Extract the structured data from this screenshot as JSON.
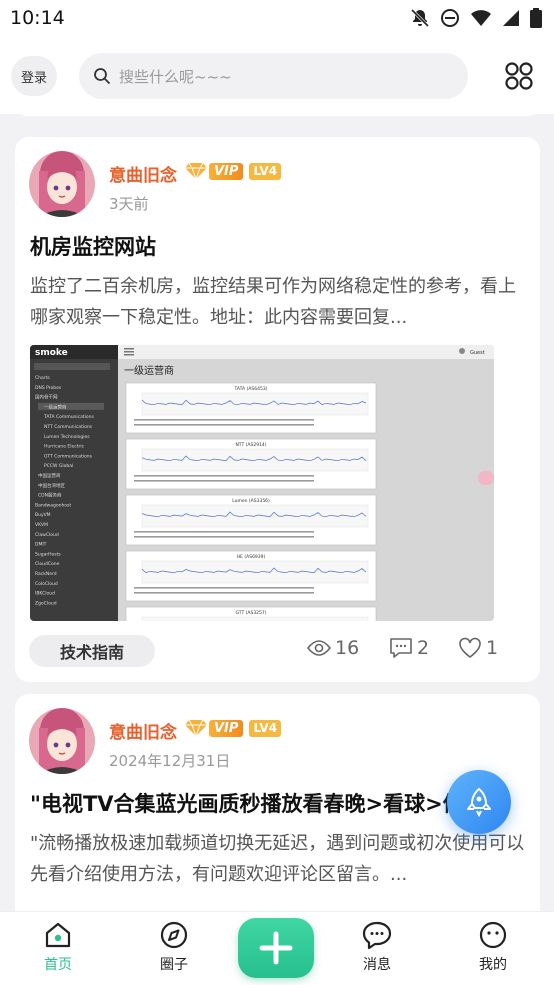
{
  "status_bar": {
    "time": "10:14"
  },
  "header": {
    "login_label": "登录",
    "search_placeholder": "搜些什么呢~~~"
  },
  "posts": [
    {
      "author": "意曲旧念",
      "vip_label": "VIP",
      "level": "LV4",
      "time": "3天前",
      "title": "机房监控网站",
      "excerpt": "监控了二百余机房，监控结果可作为网络稳定性的参考，看上哪家观察一下稳定性。地址：此内容需要回复...",
      "tag": "技术指南",
      "views": "16",
      "comments": "2",
      "likes": "1",
      "screenshot": {
        "brand": "smoke",
        "user": "Guest",
        "heading": "一级运营商",
        "sidebar": [
          "Charts",
          "DNS Probes",
          "国内骨干网",
          "一级运营商",
          "TATA Communications",
          "NTT Communications",
          "Lumen Technologies",
          "Hurricane Electric",
          "GTT Communications",
          "PCCW Global",
          "中国运营商",
          "中国台湾地区",
          "CDN服务商",
          "Bandwagonhost",
          "BuyVM",
          "VKVM",
          "ClawCloud",
          "DMIT",
          "SugarHosts",
          "CloudCone",
          "RackNerd",
          "ColoCloud",
          "IBKCloud",
          "ZgoCloud"
        ],
        "graphs": [
          "TATA (AS6453)",
          "NTT (AS2914)",
          "Lumen (AS3356)",
          "HE (AS6939)",
          "GTT (AS3257)"
        ]
      }
    },
    {
      "author": "意曲旧念",
      "vip_label": "VIP",
      "level": "LV4",
      "time": "2024年12月31日",
      "title": "\"电视TV合集蓝光画质秒播放看春晚>看球>体育\"",
      "excerpt": "\"流畅播放极速加载频道切换无延迟，遇到问题或初次使用可以先看介绍使用方法，有问题欢迎评论区留言。..."
    }
  ],
  "tabbar": {
    "home": "首页",
    "circle": "圈子",
    "messages": "消息",
    "mine": "我的"
  },
  "colors": {
    "accent": "#2bbf92",
    "author": "#e8602c",
    "rocket": "#3a90f2"
  }
}
